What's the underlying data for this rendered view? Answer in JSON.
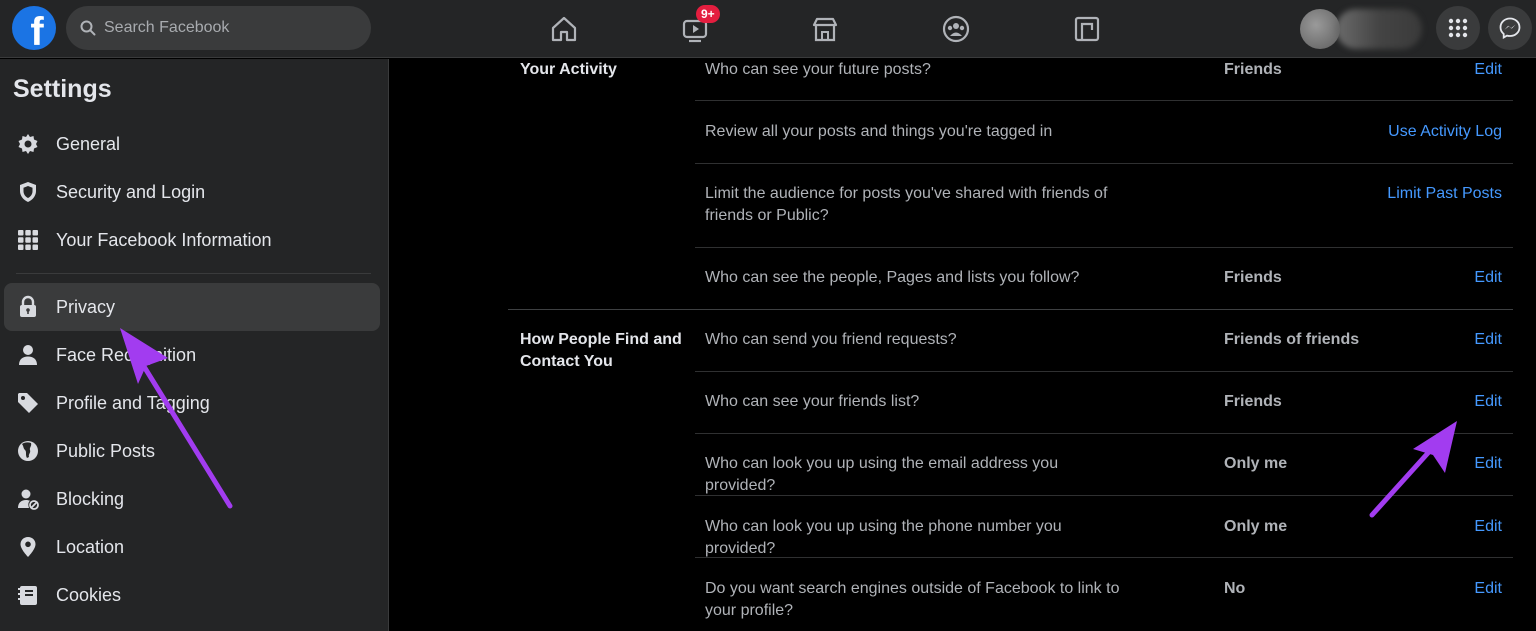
{
  "topbar": {
    "logo_letter": "f",
    "search_placeholder": "Search Facebook",
    "watch_badge": "9+",
    "nav_icons": [
      "home-icon",
      "watch-icon",
      "marketplace-icon",
      "groups-icon",
      "gaming-icon"
    ]
  },
  "sidebar": {
    "title": "Settings",
    "items": [
      {
        "label": "General",
        "icon": "gear-icon"
      },
      {
        "label": "Security and Login",
        "icon": "shield-icon"
      },
      {
        "label": "Your Facebook Information",
        "icon": "grid-icon"
      },
      {
        "label": "Privacy",
        "icon": "lock-icon",
        "active": true
      },
      {
        "label": "Face Recognition",
        "icon": "person-icon"
      },
      {
        "label": "Profile and Tagging",
        "icon": "tag-icon"
      },
      {
        "label": "Public Posts",
        "icon": "globe-icon"
      },
      {
        "label": "Blocking",
        "icon": "blocking-icon"
      },
      {
        "label": "Location",
        "icon": "location-pin-icon"
      },
      {
        "label": "Cookies",
        "icon": "cookies-icon"
      }
    ]
  },
  "sections": {
    "activity": {
      "title": "Your Activity",
      "rows": [
        {
          "question": "Who can see your future posts?",
          "value": "Friends",
          "action": "Edit"
        },
        {
          "question": "Review all your posts and things you're tagged in",
          "value": "",
          "action": "Use Activity Log"
        },
        {
          "question": "Limit the audience for posts you've shared with friends of friends or Public?",
          "value": "",
          "action": "Limit Past Posts"
        },
        {
          "question": "Who can see the people, Pages and lists you follow?",
          "value": "Friends",
          "action": "Edit"
        }
      ]
    },
    "find_contact": {
      "title": "How People Find and Contact You",
      "rows": [
        {
          "question": "Who can send you friend requests?",
          "value": "Friends of friends",
          "action": "Edit"
        },
        {
          "question": "Who can see your friends list?",
          "value": "Friends",
          "action": "Edit"
        },
        {
          "question": "Who can look you up using the email address you provided?",
          "value": "Only me",
          "action": "Edit"
        },
        {
          "question": "Who can look you up using the phone number you provided?",
          "value": "Only me",
          "action": "Edit"
        },
        {
          "question": "Do you want search engines outside of Facebook to link to your profile?",
          "value": "No",
          "action": "Edit"
        }
      ]
    }
  },
  "colors": {
    "accent": "#4599ff",
    "annotation_arrow": "#a23cf0",
    "background": "#000000",
    "panel": "#242526"
  }
}
